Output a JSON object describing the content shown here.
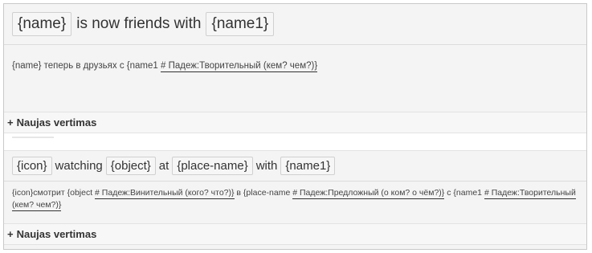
{
  "rows": [
    {
      "source_parts": [
        {
          "type": "ph",
          "text": "{name}"
        },
        {
          "type": "text",
          "text": "is now friends with"
        },
        {
          "type": "ph",
          "text": "{name1}"
        }
      ],
      "translation_parts": [
        {
          "text": "{name} теперь в друзьях с {name1 ",
          "u": false
        },
        {
          "text": "# Падеж:Творительный (кем? чем?)}",
          "u": true
        }
      ],
      "add_label": "Naujas vertimas"
    },
    {
      "source_parts": [
        {
          "type": "ph",
          "text": "{icon}"
        },
        {
          "type": "text",
          "text": "watching"
        },
        {
          "type": "ph",
          "text": "{object}"
        },
        {
          "type": "text",
          "text": "at"
        },
        {
          "type": "ph",
          "text": "{place-name}"
        },
        {
          "type": "text",
          "text": "with"
        },
        {
          "type": "ph",
          "text": "{name1}"
        }
      ],
      "translation_parts": [
        {
          "text": "{icon}смотрит {object ",
          "u": false
        },
        {
          "text": "# Падеж:Винительный (кого? что?)}",
          "u": true
        },
        {
          "text": " в {place-name ",
          "u": false
        },
        {
          "text": "# Падеж:Предложный (о ком? о чём?)}",
          "u": true
        },
        {
          "text": " с {name1 ",
          "u": false
        },
        {
          "text": "# Падеж:Творительный (кем? чем?)}",
          "u": true
        }
      ],
      "add_label": "Naujas vertimas"
    }
  ],
  "plus_symbol": "+",
  "icons": {
    "add": "plus-icon"
  }
}
